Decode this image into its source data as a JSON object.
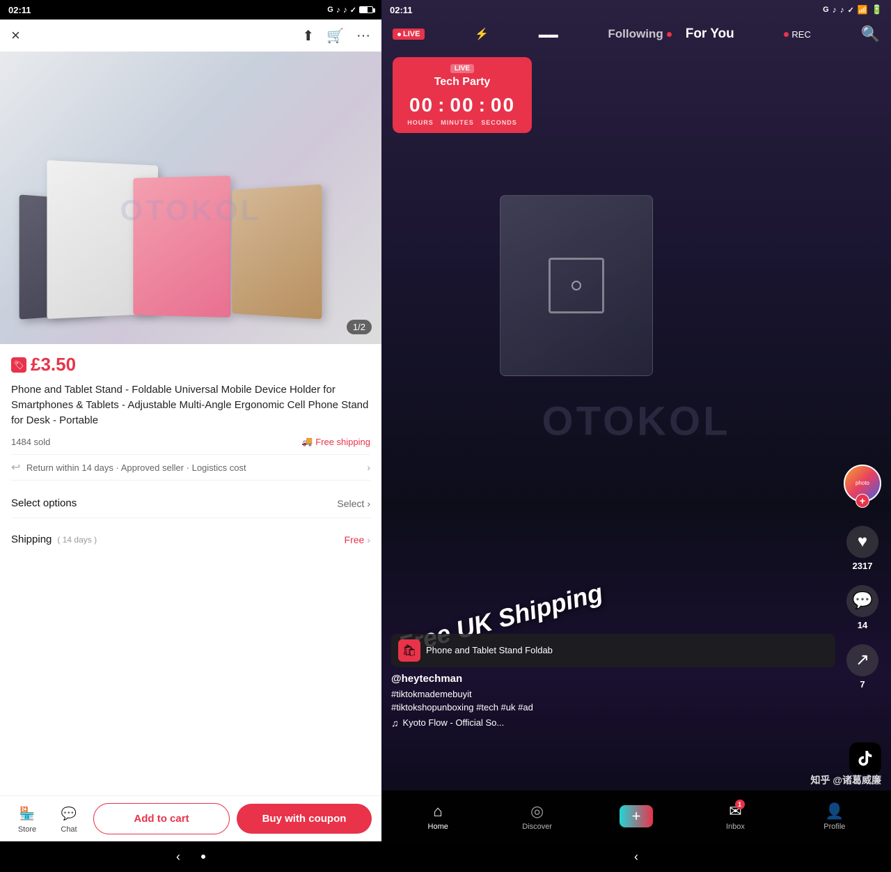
{
  "left": {
    "status_time": "02:11",
    "nav": {
      "close_label": "×",
      "share_label": "⬆",
      "cart_label": "🛒",
      "more_label": "···"
    },
    "product": {
      "price": "£3.50",
      "image_counter": "1/2",
      "title": "Phone and Tablet Stand - Foldable Universal Mobile Device Holder for Smartphones & Tablets - Adjustable Multi-Angle Ergonomic Cell Phone Stand for Desk - Portable",
      "sold": "1484 sold",
      "free_shipping": "Free shipping",
      "return_text": "Return within 14 days · Approved seller · Logistics cost",
      "watermark": "OTOKOL"
    },
    "select_options": {
      "label": "Select options",
      "button": "Select"
    },
    "shipping": {
      "label": "Shipping",
      "days": "( 14 days )",
      "value": "Free"
    },
    "bottom_bar": {
      "store_label": "Store",
      "chat_label": "Chat",
      "add_cart_label": "Add to cart",
      "buy_label": "Buy with coupon"
    }
  },
  "right": {
    "status_time": "02:11",
    "tabs": {
      "following": "Following",
      "for_you": "For You",
      "rec": "REC"
    },
    "timer": {
      "live_badge": "LIVE",
      "event_name": "Tech Party",
      "hours": "00",
      "minutes": "00",
      "seconds": "00",
      "hours_label": "HOURS",
      "minutes_label": "MINUTES",
      "seconds_label": "SECONDS"
    },
    "actions": {
      "likes": "2317",
      "comments": "14",
      "shares": "7"
    },
    "video": {
      "free_shipping_text": "Free UK Shipping",
      "watermark": "OTOKOL"
    },
    "product_card": {
      "name": "Phone and Tablet Stand  Foldab"
    },
    "user": {
      "username": "@heytechman",
      "hashtags": "#tiktokmademebuyit\n#tiktokshopunboxing #tech #uk #ad",
      "music": "♫  Kyoto Flow - Official So..."
    },
    "nav": {
      "home": "Home",
      "discover": "Discover",
      "inbox": "Inbox",
      "profile": "Profile",
      "inbox_badge": "1"
    },
    "watermark": "知乎 @诸葛威廉"
  }
}
